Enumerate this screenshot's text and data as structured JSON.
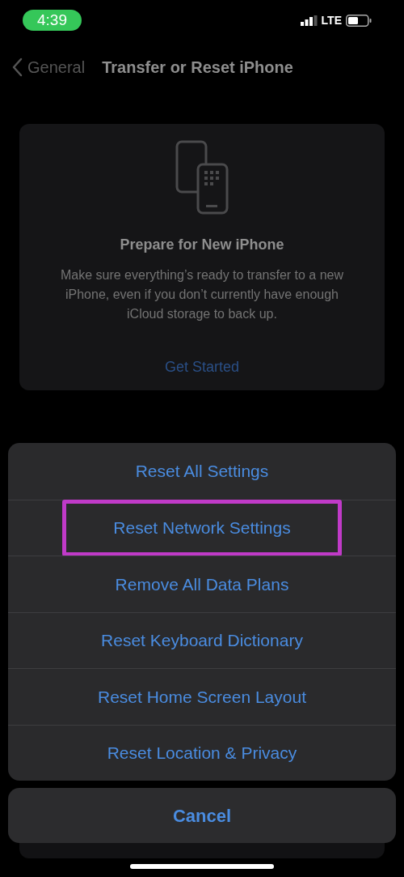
{
  "status_bar": {
    "time": "4:39",
    "network": "LTE"
  },
  "nav": {
    "back_label": "General",
    "title": "Transfer or Reset iPhone"
  },
  "card": {
    "title": "Prepare for New iPhone",
    "description": "Make sure everything’s ready to transfer to a new iPhone, even if you don’t currently have enough iCloud storage to back up.",
    "action": "Get Started"
  },
  "action_sheet": {
    "items": [
      {
        "label": "Reset All Settings",
        "highlighted": false
      },
      {
        "label": "Reset Network Settings",
        "highlighted": true
      },
      {
        "label": "Remove All Data Plans",
        "highlighted": false
      },
      {
        "label": "Reset Keyboard Dictionary",
        "highlighted": false
      },
      {
        "label": "Reset Home Screen Layout",
        "highlighted": false
      },
      {
        "label": "Reset Location & Privacy",
        "highlighted": false
      }
    ],
    "cancel": "Cancel"
  }
}
